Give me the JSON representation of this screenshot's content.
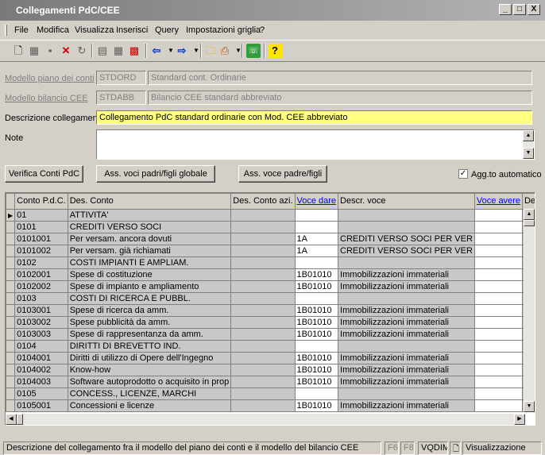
{
  "window": {
    "title": "Collegamenti PdC/CEE",
    "minimize": "_",
    "maximize": "□",
    "close": "X"
  },
  "menu": {
    "items": [
      {
        "label": "File"
      },
      {
        "label": "Modifica"
      },
      {
        "label": "Visualizza"
      },
      {
        "label": "Inserisci"
      },
      {
        "label": "Query"
      },
      {
        "label": "Impostazioni griglia"
      },
      {
        "label": "?"
      }
    ]
  },
  "toolbar": {
    "new_icon": "new-document-icon",
    "delete_icon": "close-icon",
    "refresh_icon": "refresh-icon",
    "prev_icon": "arrow-left-icon",
    "next_icon": "arrow-right-icon",
    "folder_icon": "folder-icon",
    "help_label": "?"
  },
  "form": {
    "modello_pdc": {
      "label": "Modello piano dei conti",
      "code": "STDORD",
      "desc": "Standard cont. Ordinarie"
    },
    "modello_cee": {
      "label": "Modello bilancio CEE",
      "code": "STDABB",
      "desc": "Bilancio CEE standard abbreviato"
    },
    "descrizione": {
      "label": "Descrizione collegamento",
      "value": "Collegamento PdC standard ordinarie con Mod. CEE abbreviato"
    },
    "note": {
      "label": "Note",
      "value": ""
    }
  },
  "buttons": {
    "verifica": "Verifica Conti PdC",
    "ass_globale": "Ass. voci padri/figli globale",
    "ass_voce": "Ass. voce padre/figli"
  },
  "agg_auto": {
    "label": "Agg.to automatico",
    "checked": true,
    "mark": "✓"
  },
  "grid": {
    "headers": [
      "Conto P.d.C.",
      "Des. Conto",
      "Des. Conto azi.",
      "Voce dare",
      "Descr. voce",
      "Voce avere",
      "Descr. voce"
    ],
    "rows": [
      {
        "conto": "01",
        "des": "ATTIVITA'",
        "voce_dare": "",
        "descr_dare": "",
        "parent": true,
        "selected": true
      },
      {
        "conto": "0101",
        "des": "CREDITI VERSO SOCI",
        "voce_dare": "",
        "descr_dare": "",
        "parent": true
      },
      {
        "conto": "0101001",
        "des": "Per versam. ancora dovuti",
        "voce_dare": "1A",
        "descr_dare": "CREDITI VERSO SOCI PER VER"
      },
      {
        "conto": "0101002",
        "des": "Per versam. già richiamati",
        "voce_dare": "1A",
        "descr_dare": "CREDITI VERSO SOCI PER VER"
      },
      {
        "conto": "0102",
        "des": "COSTI IMPIANTI E AMPLIAM.",
        "voce_dare": "",
        "descr_dare": "",
        "parent": true
      },
      {
        "conto": "0102001",
        "des": "Spese di costituzione",
        "voce_dare": "1B01010",
        "descr_dare": "Immobilizzazioni immateriali"
      },
      {
        "conto": "0102002",
        "des": "Spese di impianto e ampliamento",
        "voce_dare": "1B01010",
        "descr_dare": "Immobilizzazioni immateriali"
      },
      {
        "conto": "0103",
        "des": "COSTI DI RICERCA E PUBBL.",
        "voce_dare": "",
        "descr_dare": "",
        "parent": true
      },
      {
        "conto": "0103001",
        "des": "Spese di ricerca da amm.",
        "voce_dare": "1B01010",
        "descr_dare": "Immobilizzazioni immateriali"
      },
      {
        "conto": "0103002",
        "des": "Spese pubblicità da amm.",
        "voce_dare": "1B01010",
        "descr_dare": "Immobilizzazioni immateriali"
      },
      {
        "conto": "0103003",
        "des": "Spese di rappresentanza da amm.",
        "voce_dare": "1B01010",
        "descr_dare": "Immobilizzazioni immateriali"
      },
      {
        "conto": "0104",
        "des": "DIRITTI DI BREVETTO IND.",
        "voce_dare": "",
        "descr_dare": "",
        "parent": true
      },
      {
        "conto": "0104001",
        "des": "Diritti di utilizzo di Opere dell'Ingegno",
        "voce_dare": "1B01010",
        "descr_dare": "Immobilizzazioni immateriali"
      },
      {
        "conto": "0104002",
        "des": "Know-how",
        "voce_dare": "1B01010",
        "descr_dare": "Immobilizzazioni immateriali"
      },
      {
        "conto": "0104003",
        "des": "Software autoprodotto o acquisito in prop",
        "voce_dare": "1B01010",
        "descr_dare": "Immobilizzazioni immateriali"
      },
      {
        "conto": "0105",
        "des": "CONCESS., LICENZE, MARCHI",
        "voce_dare": "",
        "descr_dare": "",
        "parent": true
      },
      {
        "conto": "0105001",
        "des": "Concessioni e licenze",
        "voce_dare": "1B01010",
        "descr_dare": "Immobilizzazioni immateriali"
      }
    ]
  },
  "status": {
    "message": "Descrizione del collegamento fra il modello del piano dei conti e il modello del bilancio CEE",
    "f6": "F6",
    "f8": "F8",
    "user": "VQDIM",
    "mode": "Visualizzazione"
  }
}
